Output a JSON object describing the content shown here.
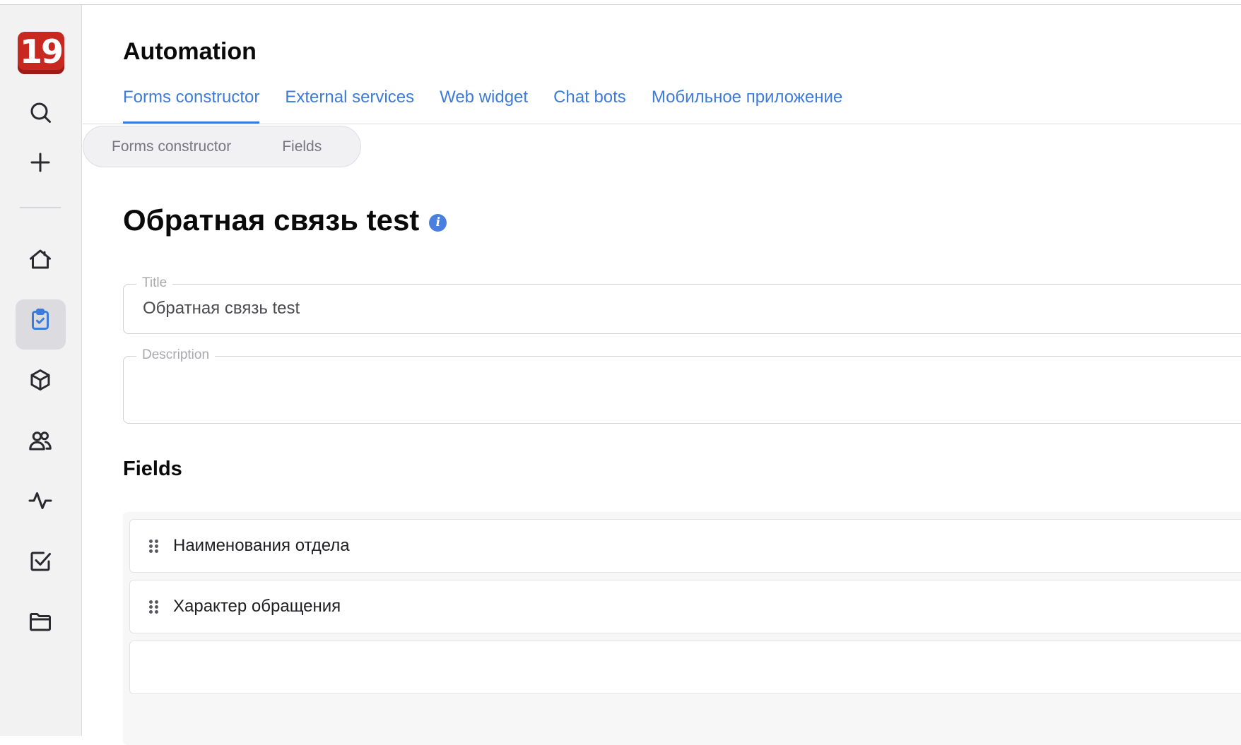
{
  "app": {
    "logo_text": "19",
    "brand_color": "#c7281f",
    "accent_color": "#3d7bd9"
  },
  "sidebar": {
    "items": [
      {
        "icon": "search-icon"
      },
      {
        "icon": "plus-icon"
      },
      {
        "icon": "home-icon"
      },
      {
        "icon": "clipboard-check-icon",
        "active": true
      },
      {
        "icon": "cube-icon"
      },
      {
        "icon": "users-icon"
      },
      {
        "icon": "activity-icon"
      },
      {
        "icon": "checkbox-icon"
      },
      {
        "icon": "folder-icon"
      }
    ]
  },
  "header": {
    "title": "Automation",
    "tabs": [
      {
        "label": "Forms constructor",
        "active": true
      },
      {
        "label": "External services"
      },
      {
        "label": "Web widget"
      },
      {
        "label": "Chat bots"
      },
      {
        "label": "Мобильное приложение"
      }
    ]
  },
  "breadcrumb": {
    "items": [
      "Forms constructor",
      "Fields"
    ]
  },
  "form": {
    "heading": "Обратная связь test",
    "title_field": {
      "label": "Title",
      "value": "Обратная связь test"
    },
    "description_field": {
      "label": "Description",
      "value": ""
    }
  },
  "fields_section": {
    "title": "Fields",
    "items": [
      {
        "label": "Наименования отдела"
      },
      {
        "label": "Характер обращения"
      }
    ]
  }
}
